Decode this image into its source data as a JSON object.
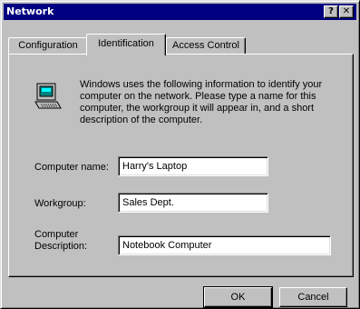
{
  "window": {
    "title": "Network",
    "help_glyph": "?",
    "close_glyph": "✕"
  },
  "tabs": [
    {
      "label": "Configuration",
      "active": false
    },
    {
      "label": "Identification",
      "active": true
    },
    {
      "label": "Access Control",
      "active": false
    }
  ],
  "identification": {
    "icon": "computer-icon",
    "info_text": "Windows uses the following information to identify your computer on the network.  Please type a name for this computer, the workgroup it will appear in, and a short description of the computer.",
    "computer_name_label": "Computer name:",
    "computer_name_value": "Harry's Laptop",
    "workgroup_label": "Workgroup:",
    "workgroup_value": "Sales Dept.",
    "description_label_line1": "Computer",
    "description_label_line2": "Description:",
    "description_value": "Notebook Computer"
  },
  "buttons": {
    "ok": "OK",
    "cancel": "Cancel"
  },
  "colors": {
    "titlebar": "#000080",
    "face": "#c0c0c0"
  }
}
